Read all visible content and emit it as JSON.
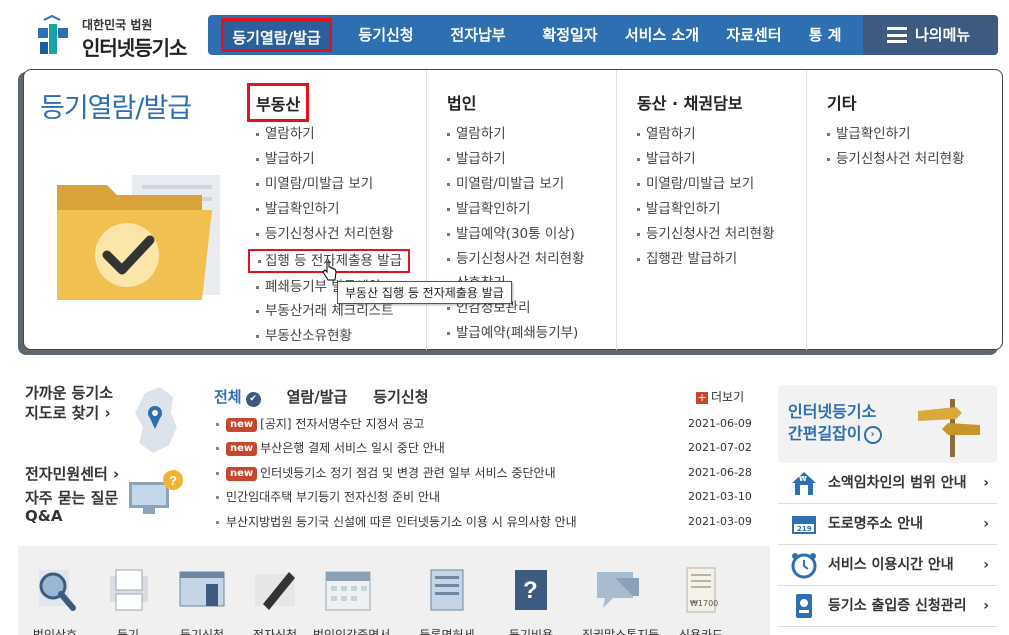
{
  "header": {
    "logo_small": "대한민국 법원",
    "logo_big": "인터넷등기소",
    "nav": [
      "등기열람/발급",
      "등기신청",
      "전자납부",
      "확정일자",
      "서비스 소개",
      "자료센터",
      "통 계"
    ],
    "my_menu": "나의메뉴"
  },
  "dropdown": {
    "title": "등기열람/발급",
    "columns": [
      {
        "title": "부동산",
        "items": [
          "열람하기",
          "발급하기",
          "미열람/미발급 보기",
          "발급확인하기",
          "등기신청사건 처리현황",
          "집행 등 전자제출용 발급",
          "폐쇄등기부 발급예약",
          "부동산거래 체크리스트",
          "부동산소유현황"
        ]
      },
      {
        "title": "법인",
        "items": [
          "열람하기",
          "발급하기",
          "미열람/미발급 보기",
          "발급확인하기",
          "발급예약(30통 이상)",
          "등기신청사건 처리현황",
          "상호찾기",
          "인감정보관리",
          "발급예약(폐쇄등기부)"
        ]
      },
      {
        "title": "동산 · 채권담보",
        "items": [
          "열람하기",
          "발급하기",
          "미열람/미발급 보기",
          "발급확인하기",
          "등기신청사건 처리현황",
          "집행관 발급하기"
        ]
      },
      {
        "title": "기타",
        "items": [
          "발급확인하기",
          "등기신청사건 처리현황"
        ]
      }
    ],
    "tooltip": "부동산 집행 등 전자제출용 발급"
  },
  "left": {
    "map_link": [
      "가까운 등기소",
      "지도로 찾기 ›"
    ],
    "center_link": "전자민원센터 ›",
    "faq_link": [
      "자주 묻는 질문",
      "Q&A"
    ]
  },
  "news": {
    "tabs": [
      "전체",
      "열람/발급",
      "등기신청"
    ],
    "more": "더보기",
    "new_label": "new",
    "items": [
      {
        "new": true,
        "title": "[공지] 전자서명수단 지정서 공고",
        "date": "2021-06-09"
      },
      {
        "new": true,
        "title": "부산은행 결제 서비스 일시 중단 안내",
        "date": "2021-07-02"
      },
      {
        "new": true,
        "title": "인터넷등기소 정기 점검 및 변경 관련 일부 서비스 중단안내",
        "date": "2021-06-28"
      },
      {
        "new": false,
        "title": "민간임대주택 부기등기 전자신청 준비 안내",
        "date": "2021-03-10"
      },
      {
        "new": false,
        "title": "부산지방법원 등기국 신설에 따른 인터넷등기소 이용 시 유의사항 안내",
        "date": "2021-03-09"
      }
    ]
  },
  "right": {
    "guide": [
      "인터넷등기소",
      "간편길잡이"
    ],
    "links": [
      "소액임차인의 범위 안내",
      "도로명주소 안내",
      "서비스 이용시간 안내",
      "등기소 출입증 신청관리"
    ]
  },
  "quick_menu": [
    "법인상호",
    "등기",
    "등기신청",
    "전자신청",
    "법인인감증명서",
    "등록면허세",
    "등기비용",
    "직권말소통지등",
    "신용카드"
  ],
  "colors": {
    "primary": "#2d6fb0",
    "highlight": "#e8101d",
    "new_badge": "#c7472c"
  }
}
